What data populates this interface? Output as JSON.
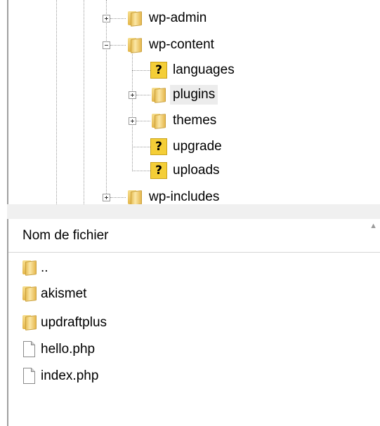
{
  "tree": {
    "nodes": [
      {
        "label": "wp-admin",
        "icon": "folder-icon",
        "expander": "plus"
      },
      {
        "label": "wp-content",
        "icon": "folder-icon",
        "expander": "minus"
      },
      {
        "label": "languages",
        "icon": "question-icon",
        "expander": "none"
      },
      {
        "label": "plugins",
        "icon": "folder-icon",
        "expander": "plus",
        "selected": true
      },
      {
        "label": "themes",
        "icon": "folder-icon",
        "expander": "plus"
      },
      {
        "label": "upgrade",
        "icon": "question-icon",
        "expander": "none"
      },
      {
        "label": "uploads",
        "icon": "question-icon",
        "expander": "none"
      },
      {
        "label": "wp-includes",
        "icon": "folder-icon",
        "expander": "plus"
      }
    ]
  },
  "file_list": {
    "column_header": "Nom de fichier",
    "sort_indicator": "▲",
    "files": [
      {
        "name": "..",
        "icon": "folder-icon"
      },
      {
        "name": "akismet",
        "icon": "folder-icon"
      },
      {
        "name": "updraftplus",
        "icon": "folder-icon"
      },
      {
        "name": "hello.php",
        "icon": "file-icon"
      },
      {
        "name": "index.php",
        "icon": "file-icon"
      }
    ]
  },
  "colors": {
    "selected_bg": "#ececec",
    "folder": "#e8c05a",
    "question": "#f4ce37"
  }
}
